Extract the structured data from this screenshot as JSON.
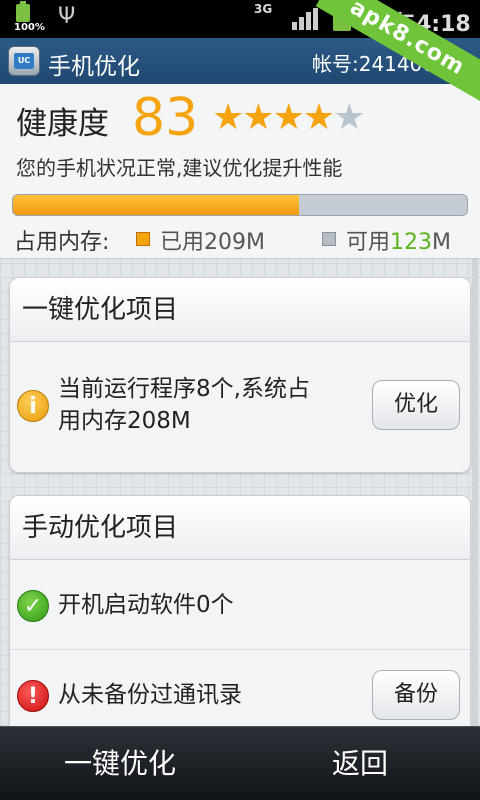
{
  "status_bar": {
    "battery_small_pct": "100%",
    "network": "3G",
    "time": "上午4:18"
  },
  "watermark": "apk8.com",
  "header": {
    "title": "手机优化",
    "account": "帐号:24140000"
  },
  "health": {
    "label": "健康度",
    "score": "83",
    "stars": [
      "★",
      "★",
      "★",
      "★",
      "★"
    ],
    "rating": 4,
    "rating_max": 5,
    "description": "您的手机状况正常,建议优化提升性能",
    "memory_usage_fraction": 0.63,
    "memory_label": "占用内存:",
    "used_label": "已用209M",
    "free_label": "可用",
    "free_value": "123",
    "free_unit": "M"
  },
  "cards": {
    "one_click": {
      "title": "一键优化项目",
      "items": [
        {
          "text_line1": "当前运行程序8个,系统占",
          "text_line2": "用内存208M",
          "button": "优化",
          "icon": "info-icon"
        }
      ]
    },
    "manual": {
      "title": "手动优化项目",
      "items": [
        {
          "text": "开机启动软件0个",
          "icon": "check-icon"
        },
        {
          "text": "从未备份过通讯录",
          "button": "备份",
          "icon": "warning-icon"
        }
      ]
    }
  },
  "bottom_bar": {
    "optimize": "一键优化",
    "back": "返回"
  },
  "colors": {
    "accent_orange": "#f5a30e",
    "free_green": "#5cb51c",
    "titlebar_blue": "#2c5a86"
  }
}
